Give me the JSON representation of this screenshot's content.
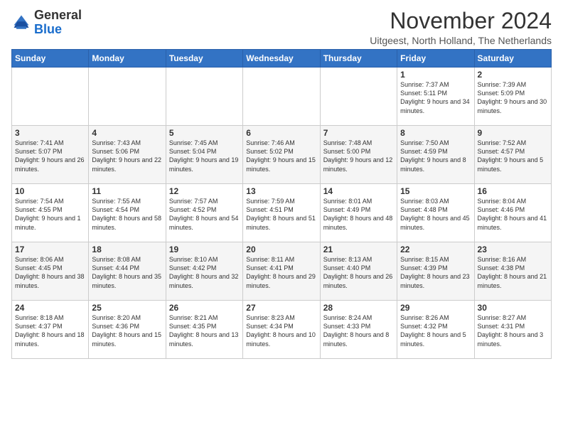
{
  "logo": {
    "general": "General",
    "blue": "Blue"
  },
  "header": {
    "title": "November 2024",
    "subtitle": "Uitgeest, North Holland, The Netherlands"
  },
  "days_of_week": [
    "Sunday",
    "Monday",
    "Tuesday",
    "Wednesday",
    "Thursday",
    "Friday",
    "Saturday"
  ],
  "weeks": [
    [
      {
        "day": "",
        "info": ""
      },
      {
        "day": "",
        "info": ""
      },
      {
        "day": "",
        "info": ""
      },
      {
        "day": "",
        "info": ""
      },
      {
        "day": "",
        "info": ""
      },
      {
        "day": "1",
        "info": "Sunrise: 7:37 AM\nSunset: 5:11 PM\nDaylight: 9 hours and 34 minutes."
      },
      {
        "day": "2",
        "info": "Sunrise: 7:39 AM\nSunset: 5:09 PM\nDaylight: 9 hours and 30 minutes."
      }
    ],
    [
      {
        "day": "3",
        "info": "Sunrise: 7:41 AM\nSunset: 5:07 PM\nDaylight: 9 hours and 26 minutes."
      },
      {
        "day": "4",
        "info": "Sunrise: 7:43 AM\nSunset: 5:06 PM\nDaylight: 9 hours and 22 minutes."
      },
      {
        "day": "5",
        "info": "Sunrise: 7:45 AM\nSunset: 5:04 PM\nDaylight: 9 hours and 19 minutes."
      },
      {
        "day": "6",
        "info": "Sunrise: 7:46 AM\nSunset: 5:02 PM\nDaylight: 9 hours and 15 minutes."
      },
      {
        "day": "7",
        "info": "Sunrise: 7:48 AM\nSunset: 5:00 PM\nDaylight: 9 hours and 12 minutes."
      },
      {
        "day": "8",
        "info": "Sunrise: 7:50 AM\nSunset: 4:59 PM\nDaylight: 9 hours and 8 minutes."
      },
      {
        "day": "9",
        "info": "Sunrise: 7:52 AM\nSunset: 4:57 PM\nDaylight: 9 hours and 5 minutes."
      }
    ],
    [
      {
        "day": "10",
        "info": "Sunrise: 7:54 AM\nSunset: 4:55 PM\nDaylight: 9 hours and 1 minute."
      },
      {
        "day": "11",
        "info": "Sunrise: 7:55 AM\nSunset: 4:54 PM\nDaylight: 8 hours and 58 minutes."
      },
      {
        "day": "12",
        "info": "Sunrise: 7:57 AM\nSunset: 4:52 PM\nDaylight: 8 hours and 54 minutes."
      },
      {
        "day": "13",
        "info": "Sunrise: 7:59 AM\nSunset: 4:51 PM\nDaylight: 8 hours and 51 minutes."
      },
      {
        "day": "14",
        "info": "Sunrise: 8:01 AM\nSunset: 4:49 PM\nDaylight: 8 hours and 48 minutes."
      },
      {
        "day": "15",
        "info": "Sunrise: 8:03 AM\nSunset: 4:48 PM\nDaylight: 8 hours and 45 minutes."
      },
      {
        "day": "16",
        "info": "Sunrise: 8:04 AM\nSunset: 4:46 PM\nDaylight: 8 hours and 41 minutes."
      }
    ],
    [
      {
        "day": "17",
        "info": "Sunrise: 8:06 AM\nSunset: 4:45 PM\nDaylight: 8 hours and 38 minutes."
      },
      {
        "day": "18",
        "info": "Sunrise: 8:08 AM\nSunset: 4:44 PM\nDaylight: 8 hours and 35 minutes."
      },
      {
        "day": "19",
        "info": "Sunrise: 8:10 AM\nSunset: 4:42 PM\nDaylight: 8 hours and 32 minutes."
      },
      {
        "day": "20",
        "info": "Sunrise: 8:11 AM\nSunset: 4:41 PM\nDaylight: 8 hours and 29 minutes."
      },
      {
        "day": "21",
        "info": "Sunrise: 8:13 AM\nSunset: 4:40 PM\nDaylight: 8 hours and 26 minutes."
      },
      {
        "day": "22",
        "info": "Sunrise: 8:15 AM\nSunset: 4:39 PM\nDaylight: 8 hours and 23 minutes."
      },
      {
        "day": "23",
        "info": "Sunrise: 8:16 AM\nSunset: 4:38 PM\nDaylight: 8 hours and 21 minutes."
      }
    ],
    [
      {
        "day": "24",
        "info": "Sunrise: 8:18 AM\nSunset: 4:37 PM\nDaylight: 8 hours and 18 minutes."
      },
      {
        "day": "25",
        "info": "Sunrise: 8:20 AM\nSunset: 4:36 PM\nDaylight: 8 hours and 15 minutes."
      },
      {
        "day": "26",
        "info": "Sunrise: 8:21 AM\nSunset: 4:35 PM\nDaylight: 8 hours and 13 minutes."
      },
      {
        "day": "27",
        "info": "Sunrise: 8:23 AM\nSunset: 4:34 PM\nDaylight: 8 hours and 10 minutes."
      },
      {
        "day": "28",
        "info": "Sunrise: 8:24 AM\nSunset: 4:33 PM\nDaylight: 8 hours and 8 minutes."
      },
      {
        "day": "29",
        "info": "Sunrise: 8:26 AM\nSunset: 4:32 PM\nDaylight: 8 hours and 5 minutes."
      },
      {
        "day": "30",
        "info": "Sunrise: 8:27 AM\nSunset: 4:31 PM\nDaylight: 8 hours and 3 minutes."
      }
    ]
  ]
}
